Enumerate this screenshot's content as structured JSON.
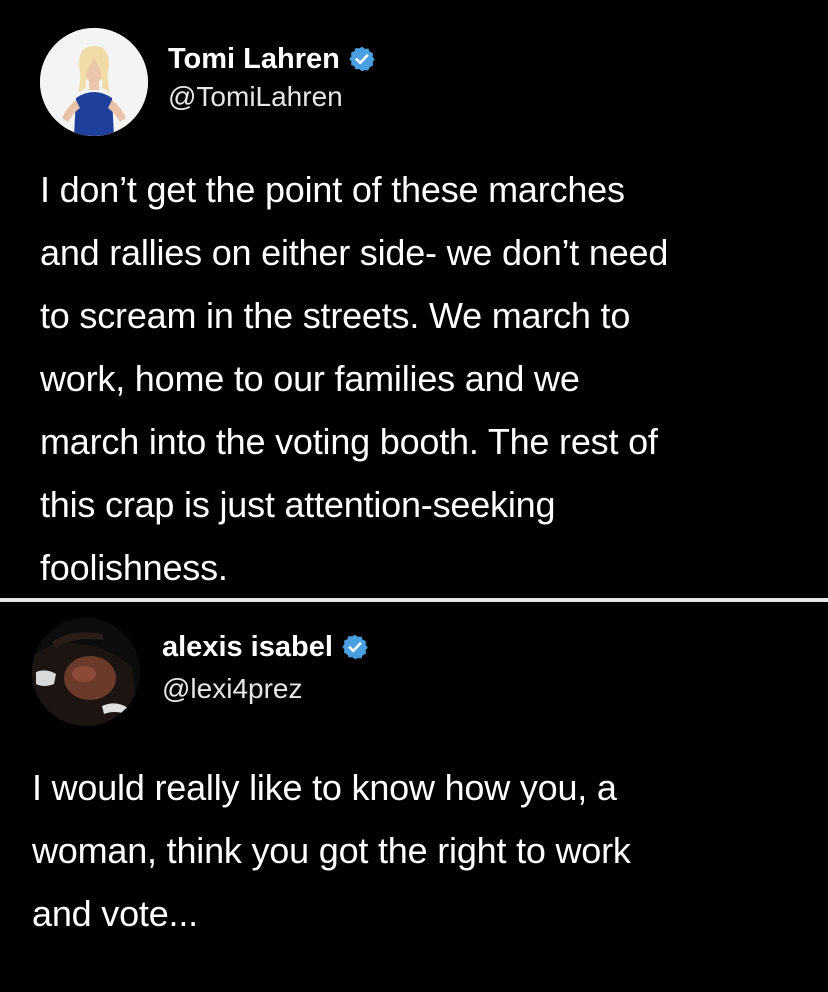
{
  "tweets": [
    {
      "display_name": "Tomi Lahren",
      "handle": "@TomiLahren",
      "verified": true,
      "lines": [
        "I don’t get the point of these marches",
        "and rallies on either side- we don’t need",
        "to scream in the streets. We march to",
        "work, home to our families and we",
        "march into the voting booth. The rest of",
        "this crap is just attention-seeking",
        "foolishness."
      ]
    },
    {
      "display_name": "alexis isabel",
      "handle": "@lexi4prez",
      "verified": true,
      "lines": [
        "I would really like to know how you, a",
        "woman, think you got the right to work",
        "and vote..."
      ]
    }
  ],
  "colors": {
    "background": "#000000",
    "text": "#ffffff",
    "verified_badge": "#4a9fe0",
    "divider": "#e8e8e8"
  },
  "icons": {
    "verified": "verified-badge-icon"
  }
}
